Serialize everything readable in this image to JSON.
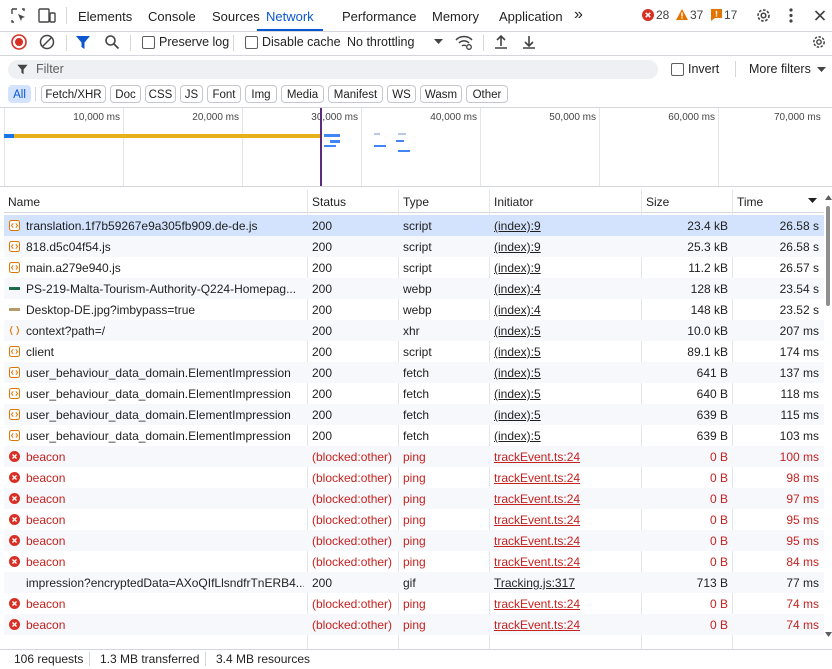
{
  "tabs": {
    "items": [
      "Elements",
      "Console",
      "Sources",
      "Network",
      "Performance",
      "Memory",
      "Application"
    ],
    "active": "Network",
    "more_label": "»",
    "errors": "28",
    "warnings": "37",
    "issues": "17"
  },
  "toolbar": {
    "preserve_log": "Preserve log",
    "disable_cache": "Disable cache",
    "throttling": "No throttling"
  },
  "filter": {
    "placeholder": "Filter",
    "invert": "Invert",
    "more_filters": "More filters"
  },
  "type_filters": [
    "All",
    "Fetch/XHR",
    "Doc",
    "CSS",
    "JS",
    "Font",
    "Img",
    "Media",
    "Manifest",
    "WS",
    "Wasm",
    "Other"
  ],
  "overview": {
    "ticks": [
      "10,000 ms",
      "20,000 ms",
      "30,000 ms",
      "40,000 ms",
      "50,000 ms",
      "60,000 ms",
      "70,000 ms"
    ]
  },
  "table": {
    "columns": {
      "name": "Name",
      "status": "Status",
      "type": "Type",
      "initiator": "Initiator",
      "size": "Size",
      "time": "Time"
    },
    "rows": [
      {
        "icon": "script",
        "name": "translation.1f7b59267e9a305fb909.de-de.js",
        "status": "200",
        "type": "script",
        "initiator": "(index):9",
        "size": "23.4 kB",
        "time": "26.58 s",
        "error": false
      },
      {
        "icon": "script",
        "name": "818.d5c04f54.js",
        "status": "200",
        "type": "script",
        "initiator": "(index):9",
        "size": "25.3 kB",
        "time": "26.58 s",
        "error": false
      },
      {
        "icon": "script",
        "name": "main.a279e940.js",
        "status": "200",
        "type": "script",
        "initiator": "(index):9",
        "size": "11.2 kB",
        "time": "26.57 s",
        "error": false
      },
      {
        "icon": "image-dark",
        "name": "PS-219-Malta-Tourism-Authority-Q224-Homepag...",
        "status": "200",
        "type": "webp",
        "initiator": "(index):4",
        "size": "128 kB",
        "time": "23.54 s",
        "error": false
      },
      {
        "icon": "image-light",
        "name": "Desktop-DE.jpg?imbypass=true",
        "status": "200",
        "type": "webp",
        "initiator": "(index):4",
        "size": "148 kB",
        "time": "23.52 s",
        "error": false
      },
      {
        "icon": "xhr",
        "name": "context?path=/",
        "status": "200",
        "type": "xhr",
        "initiator": "(index):5",
        "size": "10.0 kB",
        "time": "207 ms",
        "error": false
      },
      {
        "icon": "script",
        "name": "client",
        "status": "200",
        "type": "script",
        "initiator": "(index):5",
        "size": "89.1 kB",
        "time": "174 ms",
        "error": false
      },
      {
        "icon": "script",
        "name": "user_behaviour_data_domain.ElementImpression",
        "status": "200",
        "type": "fetch",
        "initiator": "(index):5",
        "size": "641 B",
        "time": "137 ms",
        "error": false
      },
      {
        "icon": "script",
        "name": "user_behaviour_data_domain.ElementImpression",
        "status": "200",
        "type": "fetch",
        "initiator": "(index):5",
        "size": "640 B",
        "time": "118 ms",
        "error": false
      },
      {
        "icon": "script",
        "name": "user_behaviour_data_domain.ElementImpression",
        "status": "200",
        "type": "fetch",
        "initiator": "(index):5",
        "size": "639 B",
        "time": "115 ms",
        "error": false
      },
      {
        "icon": "script",
        "name": "user_behaviour_data_domain.ElementImpression",
        "status": "200",
        "type": "fetch",
        "initiator": "(index):5",
        "size": "639 B",
        "time": "103 ms",
        "error": false
      },
      {
        "icon": "error",
        "name": "beacon",
        "status": "(blocked:other)",
        "type": "ping",
        "initiator": "trackEvent.ts:24",
        "size": "0 B",
        "time": "100 ms",
        "error": true
      },
      {
        "icon": "error",
        "name": "beacon",
        "status": "(blocked:other)",
        "type": "ping",
        "initiator": "trackEvent.ts:24",
        "size": "0 B",
        "time": "98 ms",
        "error": true
      },
      {
        "icon": "error",
        "name": "beacon",
        "status": "(blocked:other)",
        "type": "ping",
        "initiator": "trackEvent.ts:24",
        "size": "0 B",
        "time": "97 ms",
        "error": true
      },
      {
        "icon": "error",
        "name": "beacon",
        "status": "(blocked:other)",
        "type": "ping",
        "initiator": "trackEvent.ts:24",
        "size": "0 B",
        "time": "95 ms",
        "error": true
      },
      {
        "icon": "error",
        "name": "beacon",
        "status": "(blocked:other)",
        "type": "ping",
        "initiator": "trackEvent.ts:24",
        "size": "0 B",
        "time": "95 ms",
        "error": true
      },
      {
        "icon": "error",
        "name": "beacon",
        "status": "(blocked:other)",
        "type": "ping",
        "initiator": "trackEvent.ts:24",
        "size": "0 B",
        "time": "84 ms",
        "error": true
      },
      {
        "icon": "none",
        "name": "impression?encryptedData=AXoQIfLlsndfrTnERB4...",
        "status": "200",
        "type": "gif",
        "initiator": "Tracking.js:317",
        "size": "713 B",
        "time": "77 ms",
        "error": false
      },
      {
        "icon": "error",
        "name": "beacon",
        "status": "(blocked:other)",
        "type": "ping",
        "initiator": "trackEvent.ts:24",
        "size": "0 B",
        "time": "74 ms",
        "error": true
      },
      {
        "icon": "error",
        "name": "beacon",
        "status": "(blocked:other)",
        "type": "ping",
        "initiator": "trackEvent.ts:24",
        "size": "0 B",
        "time": "74 ms",
        "error": true
      }
    ]
  },
  "statusbar": {
    "requests": "106 requests",
    "transferred": "1.3 MB transferred",
    "resources": "3.4 MB resources"
  },
  "colors": {
    "accent": "#0b57d0",
    "error": "#c5221f",
    "warning": "#e37400",
    "selected_row": "#d3e3fd"
  }
}
